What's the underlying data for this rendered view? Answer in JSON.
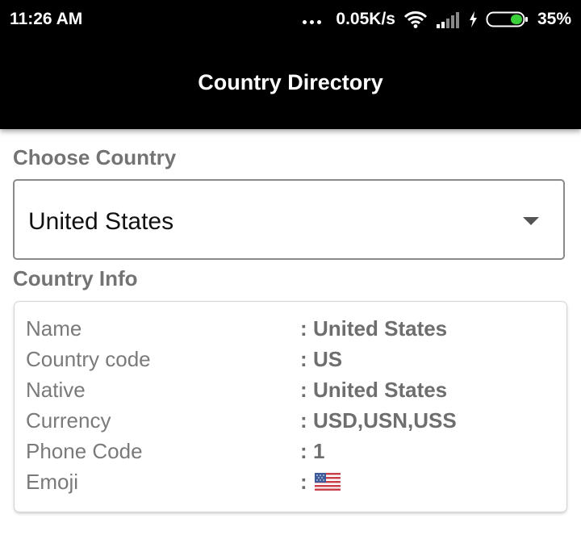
{
  "status_bar": {
    "time": "11:26 AM",
    "speed": "0.05K/s",
    "battery": "35%",
    "icons": [
      "more-dots-icon",
      "wifi-icon",
      "signal-icon",
      "charging-icon",
      "battery-icon"
    ]
  },
  "app_bar": {
    "title": "Country Directory"
  },
  "choose_country": {
    "label": "Choose Country",
    "selected": "United States"
  },
  "country_info": {
    "label": "Country Info",
    "separator": ":",
    "rows": [
      {
        "key": "Name",
        "value": "United States"
      },
      {
        "key": "Country code",
        "value": "US"
      },
      {
        "key": "Native",
        "value": "United States"
      },
      {
        "key": "Currency",
        "value": "USD,USN,USS"
      },
      {
        "key": "Phone Code",
        "value": "1"
      },
      {
        "key": "Emoji",
        "value": "🇺🇸"
      }
    ]
  },
  "colors": {
    "app_bar": "#000000",
    "label": "#737373",
    "battery_fill": "#3bd13b"
  }
}
